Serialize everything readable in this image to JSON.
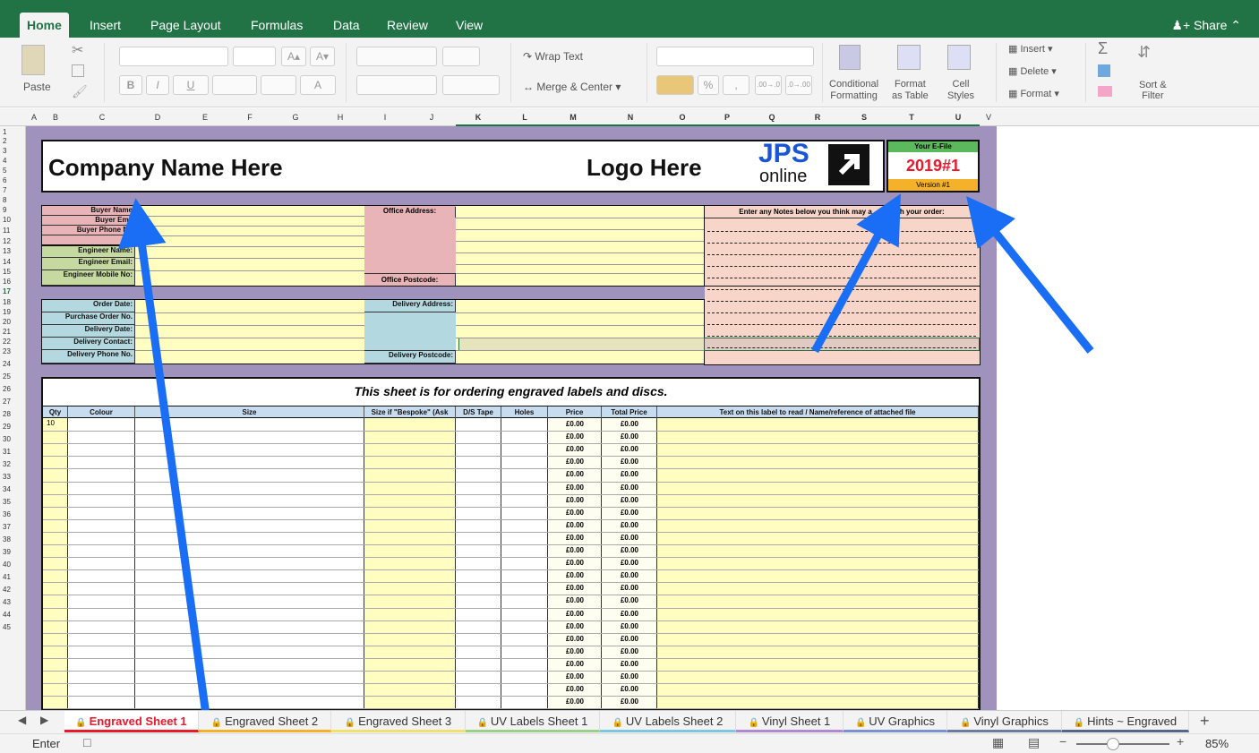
{
  "ribbon_tabs": [
    "Home",
    "Insert",
    "Page Layout",
    "Formulas",
    "Data",
    "Review",
    "View"
  ],
  "share_label": "Share",
  "ribbon": {
    "paste": "Paste",
    "wrap_text": "Wrap Text",
    "merge_center": "Merge & Center",
    "conditional": "Conditional",
    "formatting": "Formatting",
    "format": "Format",
    "as_table": "as Table",
    "cell": "Cell",
    "styles": "Styles",
    "insert": "Insert",
    "delete": "Delete",
    "format2": "Format",
    "sort": "Sort &",
    "filter": "Filter",
    "pct": "%",
    "font_grow": "A▴",
    "font_shrink": "A▾",
    "dec_add": ".00→.0",
    "dec_rem": ".0→.00"
  },
  "columns": [
    "A",
    "B",
    "C",
    "D",
    "E",
    "F",
    "G",
    "H",
    "I",
    "J",
    "K",
    "L",
    "M",
    "N",
    "O",
    "P",
    "Q",
    "R",
    "S",
    "T",
    "U",
    "V"
  ],
  "rows": [
    "1",
    "2",
    "3",
    "4",
    "5",
    "6",
    "7",
    "8",
    "9",
    "10",
    "11",
    "12",
    "13",
    "14",
    "15",
    "16",
    "17",
    "18",
    "19",
    "20",
    "21",
    "22",
    "23",
    "24",
    "25",
    "26",
    "27",
    "28",
    "29",
    "30",
    "31",
    "32",
    "33",
    "34",
    "35",
    "36",
    "37",
    "38",
    "39",
    "40",
    "41",
    "42",
    "43",
    "44",
    "45"
  ],
  "header": {
    "company": "Company Name Here",
    "logo": "Logo Here",
    "jps": "JPS",
    "online": "online",
    "efile_label": "Your E-File",
    "efile_value": "2019#1",
    "version": "Version #1"
  },
  "buyer": {
    "buyer_name": "Buyer Name",
    "buyer_email": "Buyer Ema",
    "buyer_phone": "Buyer Phone No",
    "eng_name": "Engineer Name:",
    "eng_email": "Engineer Email:",
    "eng_mobile": "Engineer Mobile No:",
    "office_address": "Office Address:",
    "office_postcode": "Office Postcode:"
  },
  "notes_header_a": "Enter any Notes below you think may a",
  "notes_header_b": "with your order:",
  "order": {
    "order_date": "Order Date:",
    "po": "Purchase Order No.",
    "del_date": "Delivery Date:",
    "del_contact": "Delivery Contact:",
    "del_phone": "Delivery Phone No.",
    "del_address": "Delivery Address:",
    "del_postcode": "Delivery Postcode:"
  },
  "sheet_title": "This sheet is for ordering engraved labels and discs.",
  "table_headers": [
    "Qty",
    "Colour",
    "Size",
    "Size if \"Bespoke\" (Ask",
    "D/S Tape",
    "Holes",
    "Price",
    "Total Price",
    "Text on this label to read / Name/reference of attached file"
  ],
  "first_qty": "10",
  "price": "£0.00",
  "sheet_tabs": [
    "Engraved Sheet 1",
    "Engraved Sheet 2",
    "Engraved Sheet 3",
    "UV Labels Sheet 1",
    "UV Labels Sheet 2",
    "Vinyl Sheet 1",
    "UV Graphics",
    "Vinyl Graphics",
    "Hints ~ Engraved"
  ],
  "status": {
    "mode": "Enter",
    "zoom": "85%"
  },
  "colors": {
    "excel_green": "#217346",
    "purple": "#9f93bd",
    "pink": "#e8b4b8",
    "green": "#c5d9a0",
    "blue": "#b4d8e0",
    "yellow": "#fffdc0",
    "red": "#e8192c",
    "orange": "#f5b129",
    "peach": "#f7d6c9",
    "arrow": "#1a6ef5"
  }
}
